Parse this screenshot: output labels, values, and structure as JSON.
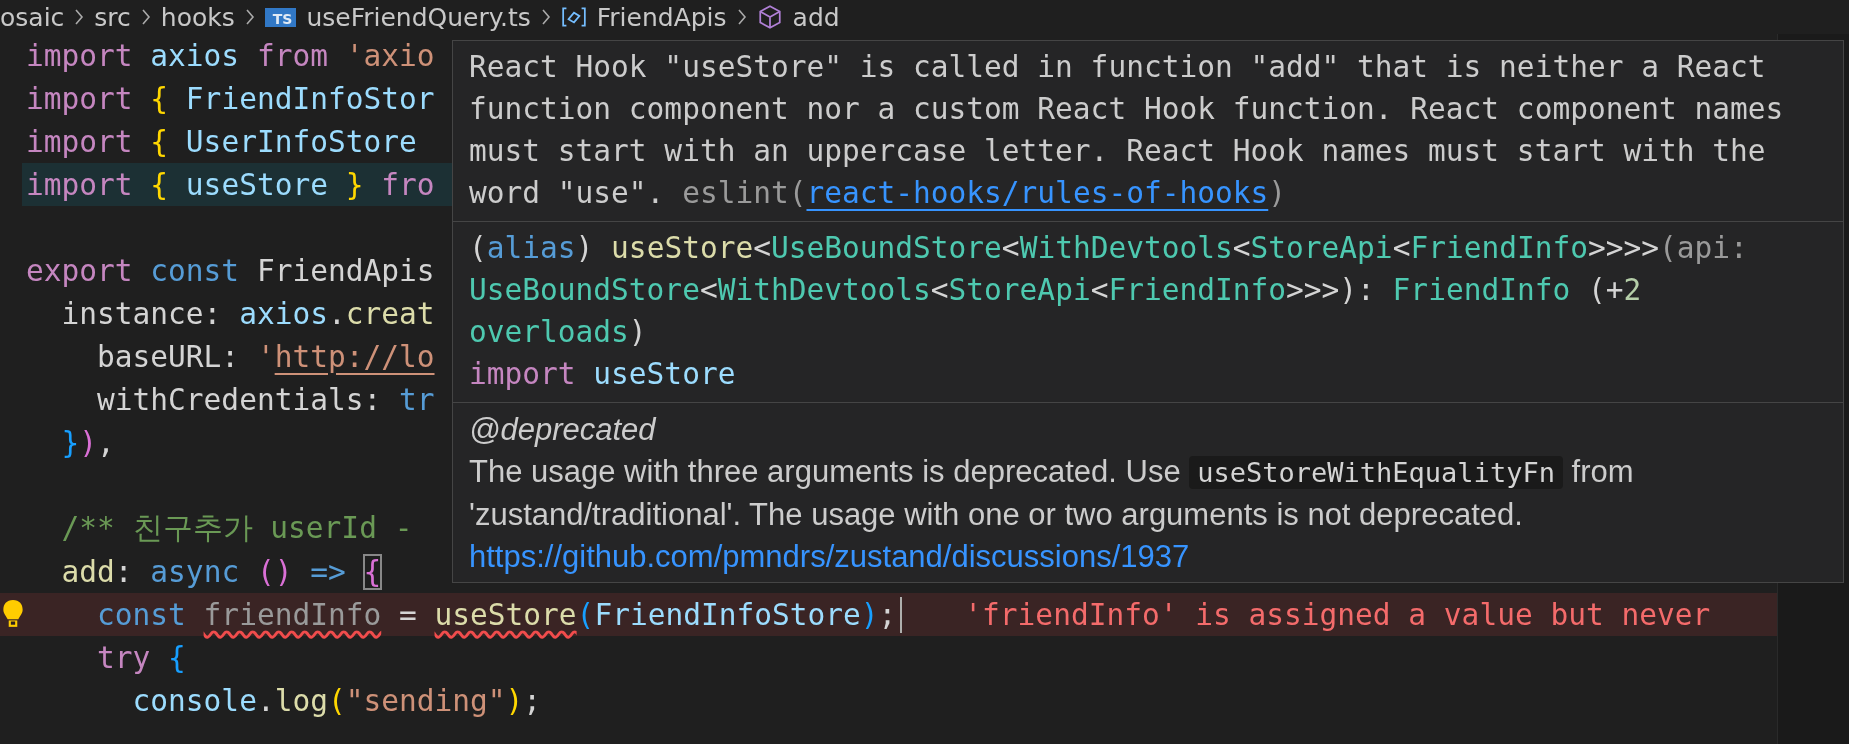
{
  "breadcrumb": [
    {
      "kind": "folder",
      "label": "osaic"
    },
    {
      "kind": "folder",
      "label": "src"
    },
    {
      "kind": "folder",
      "label": "hooks"
    },
    {
      "kind": "file",
      "badge": "TS",
      "label": "useFriendQuery.ts"
    },
    {
      "kind": "namespace",
      "label": "FriendApis"
    },
    {
      "kind": "method",
      "label": "add"
    }
  ],
  "code_lines": [
    {
      "kind": "plain",
      "tokens": [
        {
          "kind": "kw",
          "text": "import "
        },
        {
          "kind": "var",
          "text": "axios "
        },
        {
          "kind": "kw",
          "text": "from "
        },
        {
          "kind": "str",
          "text": "'axio"
        }
      ]
    },
    {
      "kind": "plain",
      "tokens": [
        {
          "kind": "kw",
          "text": "import "
        },
        {
          "kind": "b1",
          "text": "{ "
        },
        {
          "kind": "var",
          "text": "FriendInfoStor"
        }
      ]
    },
    {
      "kind": "plain",
      "tokens": [
        {
          "kind": "kw",
          "text": "import "
        },
        {
          "kind": "b1",
          "text": "{ "
        },
        {
          "kind": "var",
          "text": "UserInfoStore"
        }
      ]
    },
    {
      "kind": "current",
      "tokens": [
        {
          "kind": "kw",
          "text": "import "
        },
        {
          "kind": "b1",
          "text": "{ "
        },
        {
          "kind": "var",
          "text": "useStore "
        },
        {
          "kind": "b1",
          "text": "} "
        },
        {
          "kind": "kw",
          "text": "fro"
        }
      ]
    },
    {
      "kind": "plain"
    },
    {
      "kind": "plain",
      "tokens": [
        {
          "kind": "kw",
          "text": "export "
        },
        {
          "kind": "storage",
          "text": "const "
        },
        {
          "kind": "plain",
          "text": "FriendApis"
        }
      ]
    },
    {
      "kind": "plain",
      "tokens": [
        {
          "kind": "plain",
          "text": "  instance: "
        },
        {
          "kind": "var",
          "text": "axios"
        },
        {
          "kind": "plain",
          "text": "."
        },
        {
          "kind": "func",
          "text": "creat"
        }
      ]
    },
    {
      "kind": "plain",
      "tokens": [
        {
          "kind": "plain",
          "text": "    baseURL: "
        },
        {
          "kind": "str",
          "text": "'"
        },
        {
          "kind": "link",
          "text": "http://lo"
        }
      ]
    },
    {
      "kind": "plain",
      "tokens": [
        {
          "kind": "plain",
          "text": "    withCredentials: "
        },
        {
          "kind": "storage",
          "text": "tr"
        }
      ]
    },
    {
      "kind": "plain",
      "tokens": [
        {
          "kind": "b3",
          "text": "  }"
        },
        {
          "kind": "b2",
          "text": ")"
        },
        {
          "kind": "plain",
          "text": ","
        }
      ]
    },
    {
      "kind": "plain"
    },
    {
      "kind": "plain",
      "tokens": [
        {
          "kind": "comment",
          "text": "  /** 친구추가 userId -"
        }
      ]
    },
    {
      "kind": "plain",
      "tokens": [
        {
          "kind": "func",
          "text": "  add"
        },
        {
          "kind": "plain",
          "text": ": "
        },
        {
          "kind": "storage",
          "text": "async "
        },
        {
          "kind": "b2",
          "text": "() "
        },
        {
          "kind": "storage",
          "text": "=> "
        },
        {
          "kind": "match",
          "text": "{"
        }
      ]
    },
    {
      "kind": "error",
      "message": "'friendInfo' is assigned a value but never",
      "tokens": [
        {
          "kind": "storage",
          "text": "    const "
        },
        {
          "kind": "unused",
          "text": "friendInfo"
        },
        {
          "kind": "plain",
          "text": " = "
        },
        {
          "kind": "func-error",
          "text": "useStore"
        },
        {
          "kind": "b3",
          "text": "("
        },
        {
          "kind": "var",
          "text": "FriendInfoStore"
        },
        {
          "kind": "b3",
          "text": ")"
        },
        {
          "kind": "plain",
          "text": ";"
        }
      ]
    },
    {
      "kind": "plain",
      "tokens": [
        {
          "kind": "kw",
          "text": "    try "
        },
        {
          "kind": "b3",
          "text": "{"
        }
      ]
    },
    {
      "kind": "plain",
      "tokens": [
        {
          "kind": "var",
          "text": "      console"
        },
        {
          "kind": "plain",
          "text": "."
        },
        {
          "kind": "func",
          "text": "log"
        },
        {
          "kind": "b1",
          "text": "("
        },
        {
          "kind": "str",
          "text": "\"sending\""
        },
        {
          "kind": "b1",
          "text": ")"
        },
        {
          "kind": "plain",
          "text": ";"
        }
      ]
    }
  ],
  "hover": {
    "problem": {
      "message": "React Hook \"useStore\" is called in function \"add\" that is neither a React function component nor a custom React Hook function. React component names must start with an uppercase letter. React Hook names must start with the word \"use\".",
      "source": "eslint(",
      "rule_link": "react-hooks/rules-of-hooks",
      "source_end": ")"
    },
    "signature": [
      [
        {
          "kind": "plain",
          "text": "("
        },
        {
          "kind": "storage",
          "text": "alias"
        },
        {
          "kind": "plain",
          "text": ")"
        },
        {
          "kind": "func",
          "text": " useStore"
        },
        {
          "kind": "plain",
          "text": "<"
        },
        {
          "kind": "type",
          "text": "UseBoundStore"
        },
        {
          "kind": "plain",
          "text": "<"
        },
        {
          "kind": "type",
          "text": "WithDevtools"
        },
        {
          "kind": "plain",
          "text": "<"
        },
        {
          "kind": "type",
          "text": "StoreApi"
        },
        {
          "kind": "plain",
          "text": "<"
        },
        {
          "kind": "type",
          "text": "FriendInfo"
        },
        {
          "kind": "plain",
          "text": ">>>>"
        },
        {
          "kind": "param",
          "text": "(api: "
        },
        {
          "kind": "type",
          "text": "UseBoundStore"
        },
        {
          "kind": "plain",
          "text": "<"
        },
        {
          "kind": "type",
          "text": "WithDevtools"
        },
        {
          "kind": "plain",
          "text": "<"
        },
        {
          "kind": "type",
          "text": "StoreApi"
        },
        {
          "kind": "plain",
          "text": "<"
        },
        {
          "kind": "type",
          "text": "FriendInfo"
        },
        {
          "kind": "plain",
          "text": ">>>): "
        },
        {
          "kind": "type",
          "text": "FriendInfo"
        },
        {
          "kind": "plain",
          "text": " (+"
        },
        {
          "kind": "num",
          "text": "2"
        },
        {
          "kind": "type",
          "text": " overloads"
        },
        {
          "kind": "plain",
          "text": ")"
        }
      ],
      [
        {
          "kind": "kw",
          "text": "import "
        },
        {
          "kind": "var",
          "text": "useStore"
        }
      ]
    ],
    "doc": {
      "tag": "@deprecated",
      "text_before": "The usage with three arguments is deprecated. Use",
      "code": "useStoreWithEqualityFn",
      "text_after": "from 'zustand/traditional'. The usage with one or two arguments is not deprecated.",
      "link": "https://github.com/pmndrs/zustand/discussions/1937"
    }
  }
}
